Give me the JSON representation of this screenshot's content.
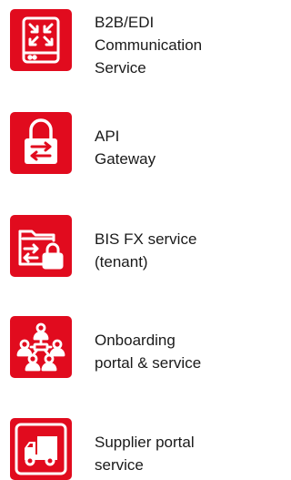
{
  "services": [
    {
      "label": "B2B/EDI\nCommunication\nService",
      "icon": "router-arrows-icon"
    },
    {
      "label": "API\nGateway",
      "icon": "lock-exchange-icon"
    },
    {
      "label": "BIS FX service\n(tenant)",
      "icon": "folder-lock-icon"
    },
    {
      "label": "Onboarding\nportal & service",
      "icon": "people-network-icon"
    },
    {
      "label": "Supplier portal\nservice",
      "icon": "truck-icon"
    }
  ],
  "colors": {
    "accent": "#e10b1e",
    "text": "#1a1a1a",
    "background": "#ffffff"
  }
}
